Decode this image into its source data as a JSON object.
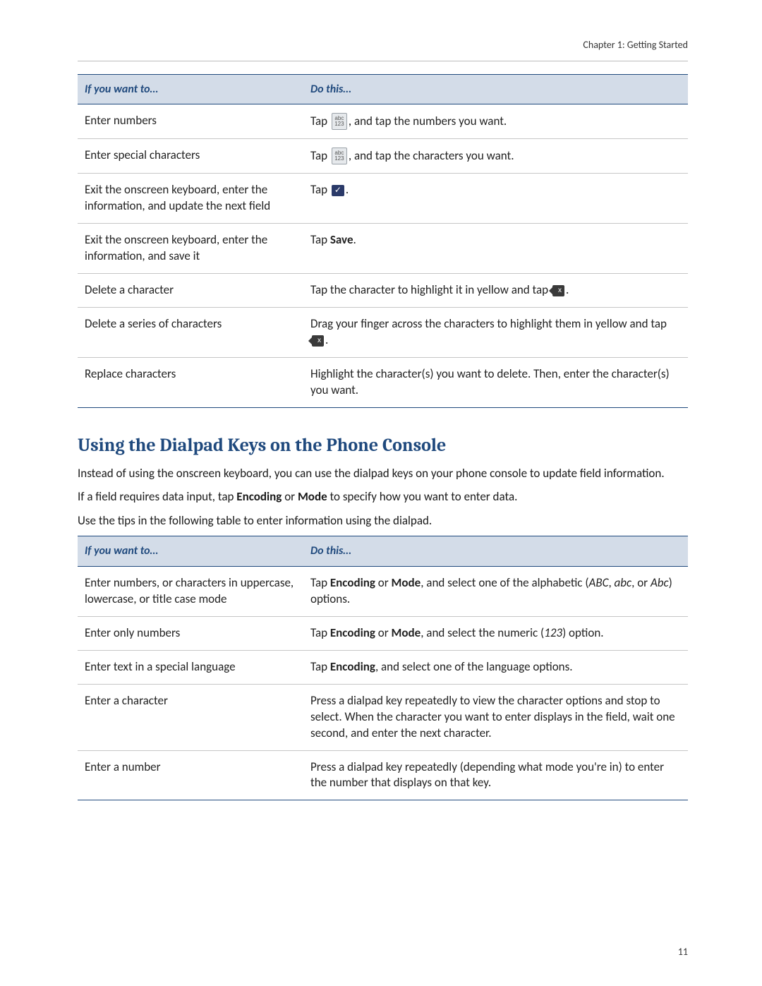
{
  "header": {
    "text": "Chapter 1: Getting Started"
  },
  "pageNumber": "11",
  "table1": {
    "headLeft": "If you want to…",
    "headRight": "Do this…",
    "rows": [
      {
        "left": "Enter numbers",
        "right": [
          {
            "t": "text",
            "v": "Tap "
          },
          {
            "t": "key",
            "icon": "num-key-icon",
            "label": "abc\n123"
          },
          {
            "t": "text",
            "v": ", and tap the numbers you want."
          }
        ]
      },
      {
        "left": "Enter special characters",
        "right": [
          {
            "t": "text",
            "v": "Tap "
          },
          {
            "t": "key",
            "icon": "num-key-icon",
            "label": "abc\n123"
          },
          {
            "t": "text",
            "v": ", and tap the characters you want."
          }
        ]
      },
      {
        "left": "Exit the onscreen keyboard, enter the information, and update the next field",
        "right": [
          {
            "t": "text",
            "v": "Tap "
          },
          {
            "t": "accept",
            "icon": "checkmark-icon"
          },
          {
            "t": "text",
            "v": "."
          }
        ]
      },
      {
        "left": "Exit the onscreen keyboard, enter the information, and save it",
        "right": [
          {
            "t": "text",
            "v": "Tap "
          },
          {
            "t": "bold",
            "v": "Save"
          },
          {
            "t": "text",
            "v": "."
          }
        ]
      },
      {
        "left": "Delete a character",
        "right": [
          {
            "t": "text",
            "v": "Tap the character to highlight it in yellow and tap "
          },
          {
            "t": "backspace",
            "icon": "backspace-icon"
          },
          {
            "t": "text",
            "v": "."
          }
        ]
      },
      {
        "left": "Delete a series of characters",
        "right": [
          {
            "t": "text",
            "v": "Drag your finger across the characters to highlight them in yellow and tap "
          },
          {
            "t": "backspace",
            "icon": "backspace-icon"
          },
          {
            "t": "text",
            "v": "."
          }
        ]
      },
      {
        "left": "Replace characters",
        "right": [
          {
            "t": "text",
            "v": "Highlight the character(s) you want to delete. Then, enter the character(s) you want."
          }
        ]
      }
    ]
  },
  "section": {
    "title": "Using the Dialpad Keys on the Phone Console",
    "paragraphs": [
      [
        {
          "t": "text",
          "v": "Instead of using the onscreen keyboard, you can use the dialpad keys on your phone console to update field information."
        }
      ],
      [
        {
          "t": "text",
          "v": "If a field requires data input, tap "
        },
        {
          "t": "bold",
          "v": "Encoding"
        },
        {
          "t": "text",
          "v": " or "
        },
        {
          "t": "bold",
          "v": "Mode"
        },
        {
          "t": "text",
          "v": " to specify how you want to enter data."
        }
      ],
      [
        {
          "t": "text",
          "v": "Use the tips in the following table to enter information using the dialpad."
        }
      ]
    ]
  },
  "table2": {
    "headLeft": "If you want to…",
    "headRight": "Do this…",
    "rows": [
      {
        "left": "Enter numbers, or characters in uppercase, lowercase, or title case mode",
        "right": [
          {
            "t": "text",
            "v": "Tap "
          },
          {
            "t": "bold",
            "v": "Encoding"
          },
          {
            "t": "text",
            "v": " or "
          },
          {
            "t": "bold",
            "v": "Mode"
          },
          {
            "t": "text",
            "v": ", and select one of the alphabetic ("
          },
          {
            "t": "italic",
            "v": "ABC"
          },
          {
            "t": "text",
            "v": ", "
          },
          {
            "t": "italic",
            "v": "abc"
          },
          {
            "t": "text",
            "v": ", or "
          },
          {
            "t": "italic",
            "v": "Abc"
          },
          {
            "t": "text",
            "v": ") options."
          }
        ]
      },
      {
        "left": "Enter only numbers",
        "right": [
          {
            "t": "text",
            "v": "Tap "
          },
          {
            "t": "bold",
            "v": "Encoding"
          },
          {
            "t": "text",
            "v": " or "
          },
          {
            "t": "bold",
            "v": "Mode"
          },
          {
            "t": "text",
            "v": ", and select the numeric ("
          },
          {
            "t": "italic",
            "v": "123"
          },
          {
            "t": "text",
            "v": ") option."
          }
        ]
      },
      {
        "left": "Enter text in a special language",
        "right": [
          {
            "t": "text",
            "v": "Tap "
          },
          {
            "t": "bold",
            "v": "Encoding"
          },
          {
            "t": "text",
            "v": ", and select one of the language options."
          }
        ]
      },
      {
        "left": "Enter a character",
        "right": [
          {
            "t": "text",
            "v": "Press a dialpad key repeatedly to view the character options and stop to select. When the character you want to enter displays in the field, wait one second, and enter the next character."
          }
        ]
      },
      {
        "left": "Enter a number",
        "right": [
          {
            "t": "text",
            "v": "Press a dialpad key repeatedly (depending what mode you're in) to enter the number that displays on that key."
          }
        ]
      }
    ]
  }
}
